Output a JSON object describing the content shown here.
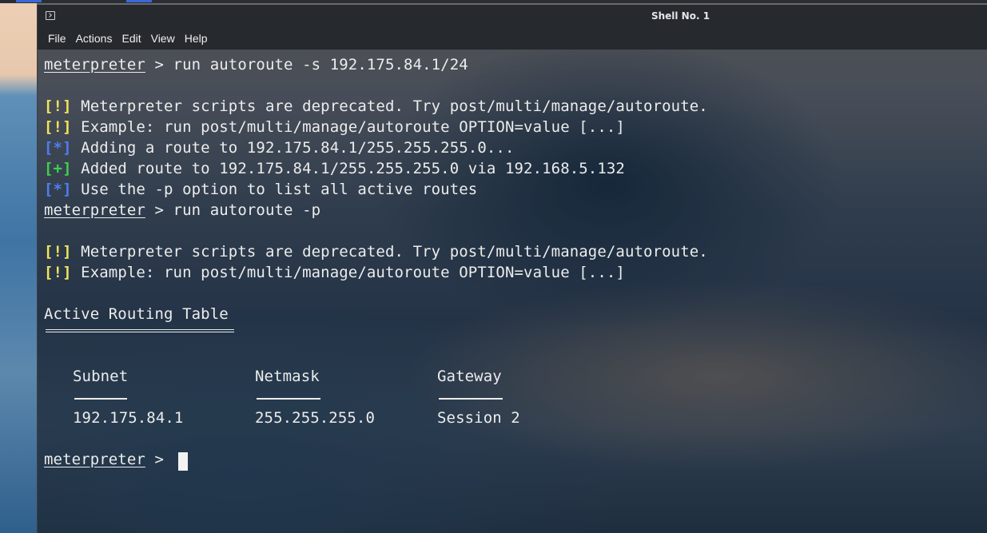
{
  "window": {
    "title": "Shell No. 1"
  },
  "menu": [
    "File",
    "Actions",
    "Edit",
    "View",
    "Help"
  ],
  "terminal": {
    "prompt": "meterpreter",
    "cmd1": " > run autoroute -s 192.175.84.1/24",
    "out1": {
      "tag": "[!]",
      "text": " Meterpreter scripts are deprecated. Try post/multi/manage/autoroute."
    },
    "out2": {
      "tag": "[!]",
      "text": " Example: run post/multi/manage/autoroute OPTION=value [...]"
    },
    "out3": {
      "tag": "[*]",
      "text": " Adding a route to 192.175.84.1/255.255.255.0..."
    },
    "out4": {
      "tag": "[+]",
      "text": " Added route to 192.175.84.1/255.255.255.0 via 192.168.5.132"
    },
    "out5": {
      "tag": "[*]",
      "text": " Use the -p option to list all active routes"
    },
    "cmd2": " > run autoroute -p",
    "out6": {
      "tag": "[!]",
      "text": " Meterpreter scripts are deprecated. Try post/multi/manage/autoroute."
    },
    "out7": {
      "tag": "[!]",
      "text": " Example: run post/multi/manage/autoroute OPTION=value [...]"
    },
    "table_title": "Active Routing Table",
    "table_headers": [
      "Subnet",
      "Netmask",
      "Gateway"
    ],
    "table_row": [
      "192.175.84.1",
      "255.255.255.0",
      "Session 2"
    ],
    "final_prompt_suffix": " > "
  },
  "colors": {
    "warn": "#f3e35b",
    "info": "#4f7ef2",
    "ok": "#3fd14b",
    "text": "#ececec"
  }
}
